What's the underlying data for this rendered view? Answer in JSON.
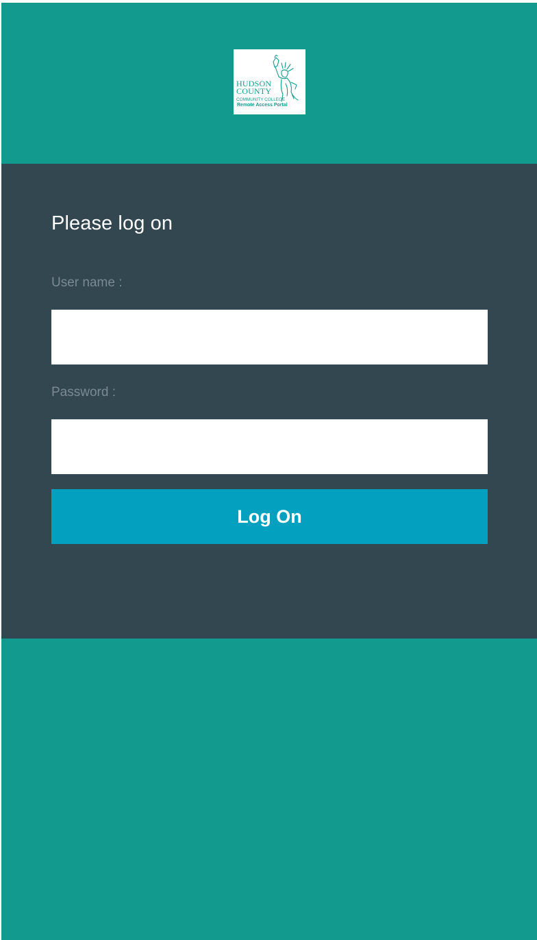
{
  "logo": {
    "line1": "HUDSON",
    "line2": "COUNTY",
    "line3": "COMMUNITY COLLEGE",
    "line4": "Remote Access Portal",
    "icon": "statue-of-liberty-icon"
  },
  "form": {
    "title": "Please log on",
    "username_label": "User name :",
    "username_value": "",
    "password_label": "Password :",
    "password_value": "",
    "submit_label": "Log On"
  },
  "colors": {
    "background_teal": "#139a8f",
    "panel_dark": "#334751",
    "button_blue": "#04a0c0",
    "label_gray": "#7a8b94"
  }
}
